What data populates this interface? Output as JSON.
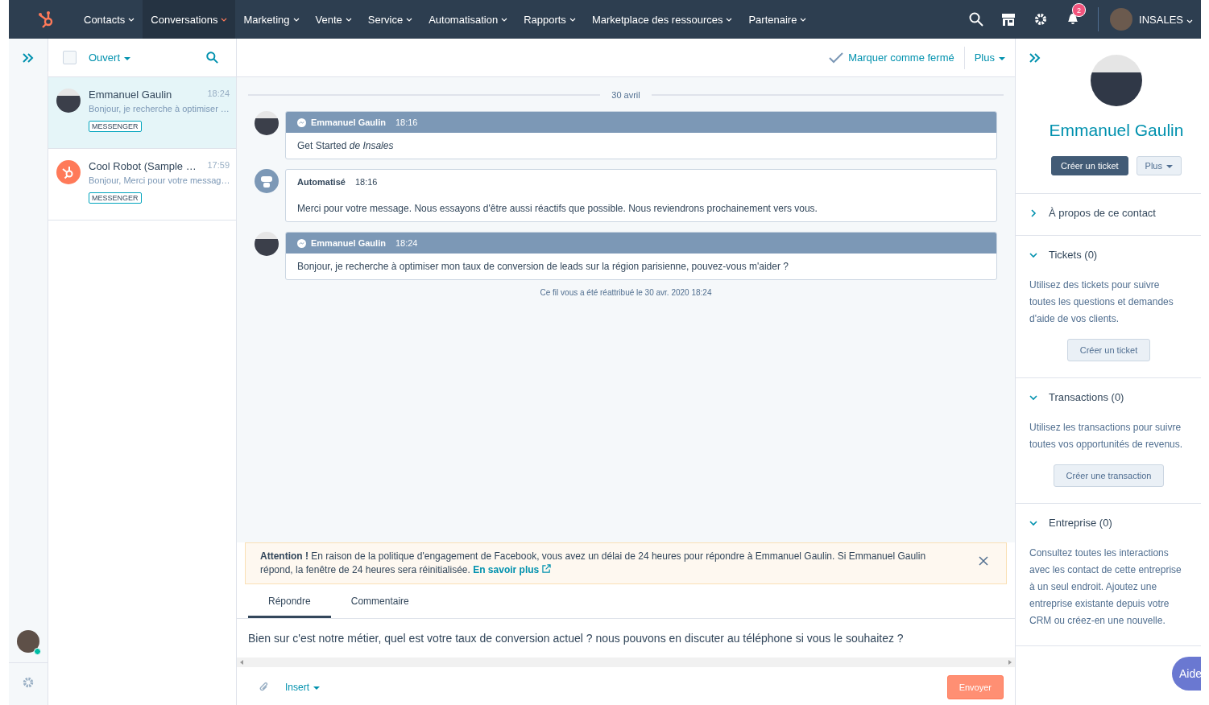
{
  "nav": {
    "items": [
      {
        "label": "Contacts",
        "selected": false
      },
      {
        "label": "Conversations",
        "selected": true
      },
      {
        "label": "Marketing",
        "selected": false
      },
      {
        "label": "Vente",
        "selected": false
      },
      {
        "label": "Service",
        "selected": false
      },
      {
        "label": "Automatisation",
        "selected": false
      },
      {
        "label": "Rapports",
        "selected": false
      },
      {
        "label": "Marketplace des ressources",
        "selected": false
      },
      {
        "label": "Partenaire",
        "selected": false
      }
    ],
    "notification_count": "2",
    "user": "INSALES"
  },
  "inbox": {
    "select_all_checked": false,
    "filter": "Ouvert",
    "conversations": [
      {
        "kind": "person",
        "name": "Emmanuel Gaulin",
        "time": "18:24",
        "preview": "Bonjour, je recherche à optimiser …",
        "tag": "MESSENGER",
        "selected": true
      },
      {
        "kind": "bot",
        "name": "Cool Robot (Sample …",
        "time": "17:59",
        "preview": "Bonjour, Merci pour votre messag…",
        "tag": "MESSENGER",
        "selected": false
      }
    ]
  },
  "thread": {
    "action": "Marquer comme fermé",
    "more": "Plus",
    "date": "30 avril",
    "messages": [
      {
        "kind": "messenger",
        "sender": "Emmanuel Gaulin",
        "time": "18:16",
        "text": "Get Started *de Insales*"
      },
      {
        "kind": "automated",
        "sender": "Automatisé",
        "time": "18:16",
        "text": "Merci pour votre message. Nous essayons d'être aussi réactifs que possible. Nous reviendrons prochainement vers vous."
      },
      {
        "kind": "messenger",
        "sender": "Emmanuel Gaulin",
        "time": "18:24",
        "text": "Bonjour, je recherche à optimiser mon taux de conversion de leads sur la région parisienne, pouvez-vous m'aider ?"
      }
    ],
    "reassigned": "Ce fil vous a été réattribué le 30 avr. 2020 18:24"
  },
  "alert": {
    "text": "**Attention !** En raison de la politique d'engagement de Facebook, vous avez un délai de 24 heures pour répondre à Emmanuel Gaulin. Si Emmanuel Gaulin répond, la fenêtre de 24 heures sera réinitialisée.",
    "link": "En savoir plus"
  },
  "composer": {
    "tabs": [
      {
        "label": "Répondre",
        "selected": true
      },
      {
        "label": "Commentaire",
        "selected": false
      }
    ],
    "value": "Bien sur c'est notre métier, quel est votre taux de conversion actuel ? nous pouvons en discuter au téléphone si vous le souhaitez ?",
    "insert": "Insert",
    "send": "Envoyer"
  },
  "contact": {
    "name": "Emmanuel Gaulin",
    "primary": "Créer un ticket",
    "more": "Plus",
    "sections": [
      {
        "title": "À propos de ce contact",
        "expanded": false
      },
      {
        "title": "Tickets (0)",
        "expanded": true,
        "text": "Utilisez des tickets pour suivre toutes les questions et demandes d'aide de vos clients.",
        "button": "Créer un ticket"
      },
      {
        "title": "Transactions (0)",
        "expanded": true,
        "text": "Utilisez les transactions pour suivre toutes vos opportunités de revenus.",
        "button": "Créer une transaction"
      },
      {
        "title": "Entreprise (0)",
        "expanded": true,
        "text": "Consultez toutes les interactions avec les contact de cette entreprise à un seul endroit. Ajoutez une entreprise existante depuis votre CRM ou créez-en une nouvelle."
      }
    ]
  },
  "help": "Aide"
}
